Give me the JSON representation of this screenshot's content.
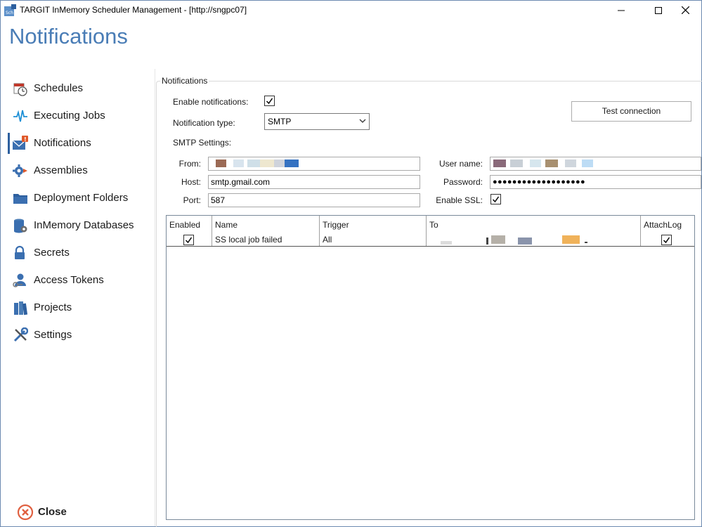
{
  "window": {
    "title": "TARGIT InMemory Scheduler Management - [http://sngpc07]",
    "app_icon": "scheduler-app-icon"
  },
  "page_title": "Notifications",
  "sidebar": {
    "items": [
      {
        "label": "Schedules",
        "icon": "clock-calendar-icon"
      },
      {
        "label": "Executing Jobs",
        "icon": "pulse-icon"
      },
      {
        "label": "Notifications",
        "icon": "mail-alert-icon",
        "active": true
      },
      {
        "label": "Assemblies",
        "icon": "gear-arrow-icon"
      },
      {
        "label": "Deployment Folders",
        "icon": "folder-icon"
      },
      {
        "label": "InMemory Databases",
        "icon": "database-icon"
      },
      {
        "label": "Secrets",
        "icon": "lock-icon"
      },
      {
        "label": "Access Tokens",
        "icon": "user-key-icon"
      },
      {
        "label": "Projects",
        "icon": "books-icon"
      },
      {
        "label": "Settings",
        "icon": "tools-icon"
      }
    ],
    "close_label": "Close"
  },
  "notifications": {
    "group_label": "Notifications",
    "enable_label": "Enable notifications:",
    "enable_checked": true,
    "type_label": "Notification type:",
    "type_value": "SMTP",
    "test_button": "Test connection",
    "smtp_label": "SMTP Settings:",
    "from_label": "From:",
    "host_label": "Host:",
    "host_value": "smtp.gmail.com",
    "port_label": "Port:",
    "port_value": "587",
    "user_label": "User name:",
    "password_label": "Password:",
    "password_value": "●●●●●●●●●●●●●●●●●●●",
    "ssl_label": "Enable SSL:",
    "ssl_checked": true
  },
  "grid": {
    "columns": [
      "Enabled",
      "Name",
      "Trigger",
      "To",
      "AttachLog"
    ],
    "rows": [
      {
        "enabled": true,
        "name": "SS local job failed",
        "trigger": "All",
        "attach_log": true
      }
    ]
  },
  "colors": {
    "title_blue": "#4a7db6",
    "accent": "#2d5f9e"
  }
}
